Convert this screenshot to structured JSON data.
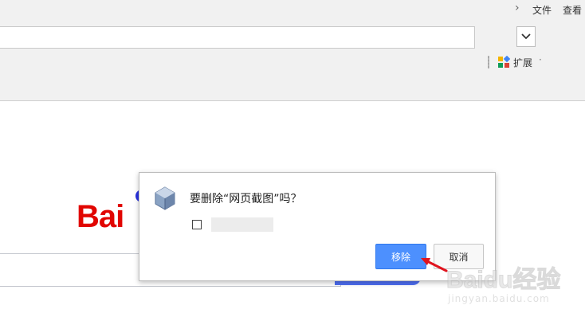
{
  "menu": {
    "file_label": "文件",
    "view_label": "查看"
  },
  "toolbar": {
    "extensions_label": "扩展"
  },
  "dialog": {
    "title": "要删除“网页截图”吗？",
    "checkbox_label": "",
    "remove_label": "移除",
    "cancel_label": "取消"
  },
  "page": {
    "logo_text": "Bai"
  },
  "watermark": {
    "brand": "Baidu经验",
    "url": "jingyan.baidu.com"
  },
  "colors": {
    "primary_button": "#4d90fe",
    "logo_red": "#e10601",
    "search_blue": "#4e6ef2",
    "arrow_red": "#e0141e"
  },
  "icons": [
    "chevron-right-icon",
    "dropdown-arrow-icon",
    "extensions-icon",
    "extension-cube-icon",
    "red-arrow-icon"
  ]
}
